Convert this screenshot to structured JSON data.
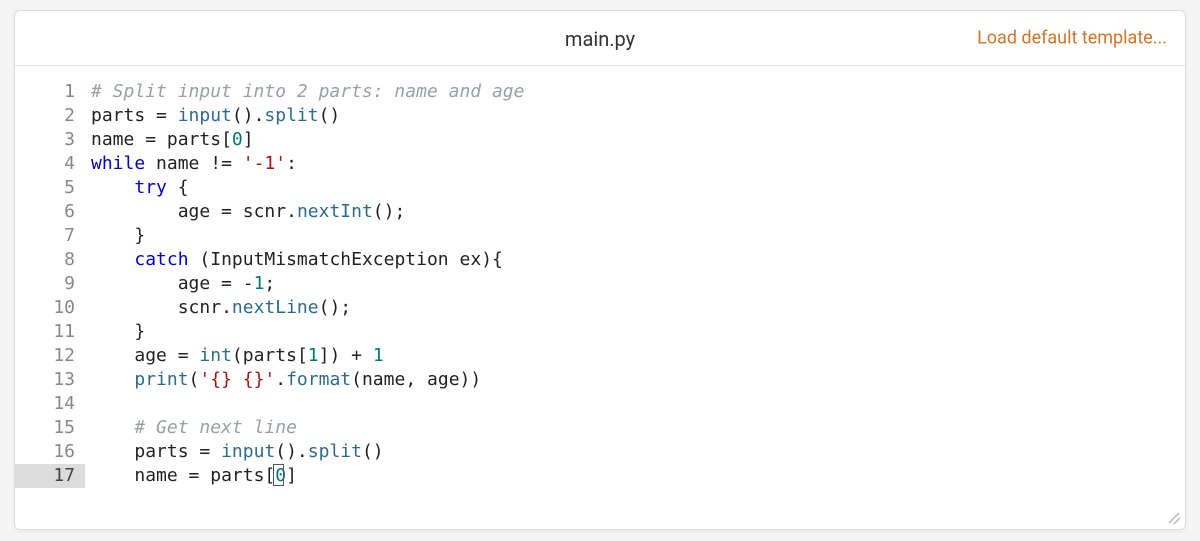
{
  "header": {
    "filename": "main.py",
    "load_link": "Load default template..."
  },
  "editor": {
    "active_line": 17,
    "line_numbers": [
      "1",
      "2",
      "3",
      "4",
      "5",
      "6",
      "7",
      "8",
      "9",
      "10",
      "11",
      "12",
      "13",
      "14",
      "15",
      "16",
      "17"
    ],
    "code_plain": [
      "# Split input into 2 parts: name and age",
      "parts = input().split()",
      "name = parts[0]",
      "while name != '-1':",
      "    try {",
      "        age = scnr.nextInt();",
      "    }",
      "    catch (InputMismatchException ex){",
      "        age = -1;",
      "        scnr.nextLine();",
      "    }",
      "    age = int(parts[1]) + 1",
      "    print('{} {}'.format(name, age))",
      "",
      "    # Get next line",
      "    parts = input().split()",
      "    name = parts[0]"
    ],
    "tokens": {
      "l1_comment": "# Split input into 2 parts: name and age",
      "l2_parts": "parts",
      "l2_eq": " = ",
      "l2_input": "input",
      "l2_p1": "().",
      "l2_split": "split",
      "l2_p2": "()",
      "l3_name": "name",
      "l3_eq": " = ",
      "l3_parts": "parts",
      "l3_lb": "[",
      "l3_zero": "0",
      "l3_rb": "]",
      "l4_while": "while",
      "l4_sp": " ",
      "l4_name": "name",
      "l4_ne": " != ",
      "l4_str": "'-1'",
      "l4_colon": ":",
      "l5_indent": "    ",
      "l5_try": "try",
      "l5_brace": " {",
      "l6_indent": "        ",
      "l6_age": "age",
      "l6_eq": " = ",
      "l6_scnr": "scnr",
      "l6_dot": ".",
      "l6_next": "nextInt",
      "l6_p": "();",
      "l7_indent": "    ",
      "l7_brace": "}",
      "l8_indent": "    ",
      "l8_catch": "catch",
      "l8_sp": " (",
      "l8_exc": "InputMismatchException",
      "l8_sp2": " ",
      "l8_ex": "ex",
      "l8_close": "){",
      "l9_indent": "        ",
      "l9_age": "age",
      "l9_eq": " = ",
      "l9_neg": "-",
      "l9_one": "1",
      "l9_semi": ";",
      "l10_indent": "        ",
      "l10_scnr": "scnr",
      "l10_dot": ".",
      "l10_next": "nextLine",
      "l10_p": "();",
      "l11_indent": "    ",
      "l11_brace": "}",
      "l12_indent": "    ",
      "l12_age": "age",
      "l12_eq": " = ",
      "l12_int": "int",
      "l12_lp": "(",
      "l12_parts": "parts",
      "l12_lb": "[",
      "l12_one": "1",
      "l12_rb": "]) + ",
      "l12_one2": "1",
      "l13_indent": "    ",
      "l13_print": "print",
      "l13_lp": "(",
      "l13_str": "'{} {}'",
      "l13_dot": ".",
      "l13_fmt": "format",
      "l13_lp2": "(",
      "l13_name": "name",
      "l13_comma": ", ",
      "l13_age": "age",
      "l13_rp": "))",
      "l15_indent": "    ",
      "l15_comment": "# Get next line",
      "l16_indent": "    ",
      "l16_parts": "parts",
      "l16_eq": " = ",
      "l16_input": "input",
      "l16_p1": "().",
      "l16_split": "split",
      "l16_p2": "()",
      "l17_indent": "    ",
      "l17_name": "name",
      "l17_eq": " = ",
      "l17_parts": "parts",
      "l17_lb": "[",
      "l17_zero": "0",
      "l17_rb": "]"
    }
  }
}
